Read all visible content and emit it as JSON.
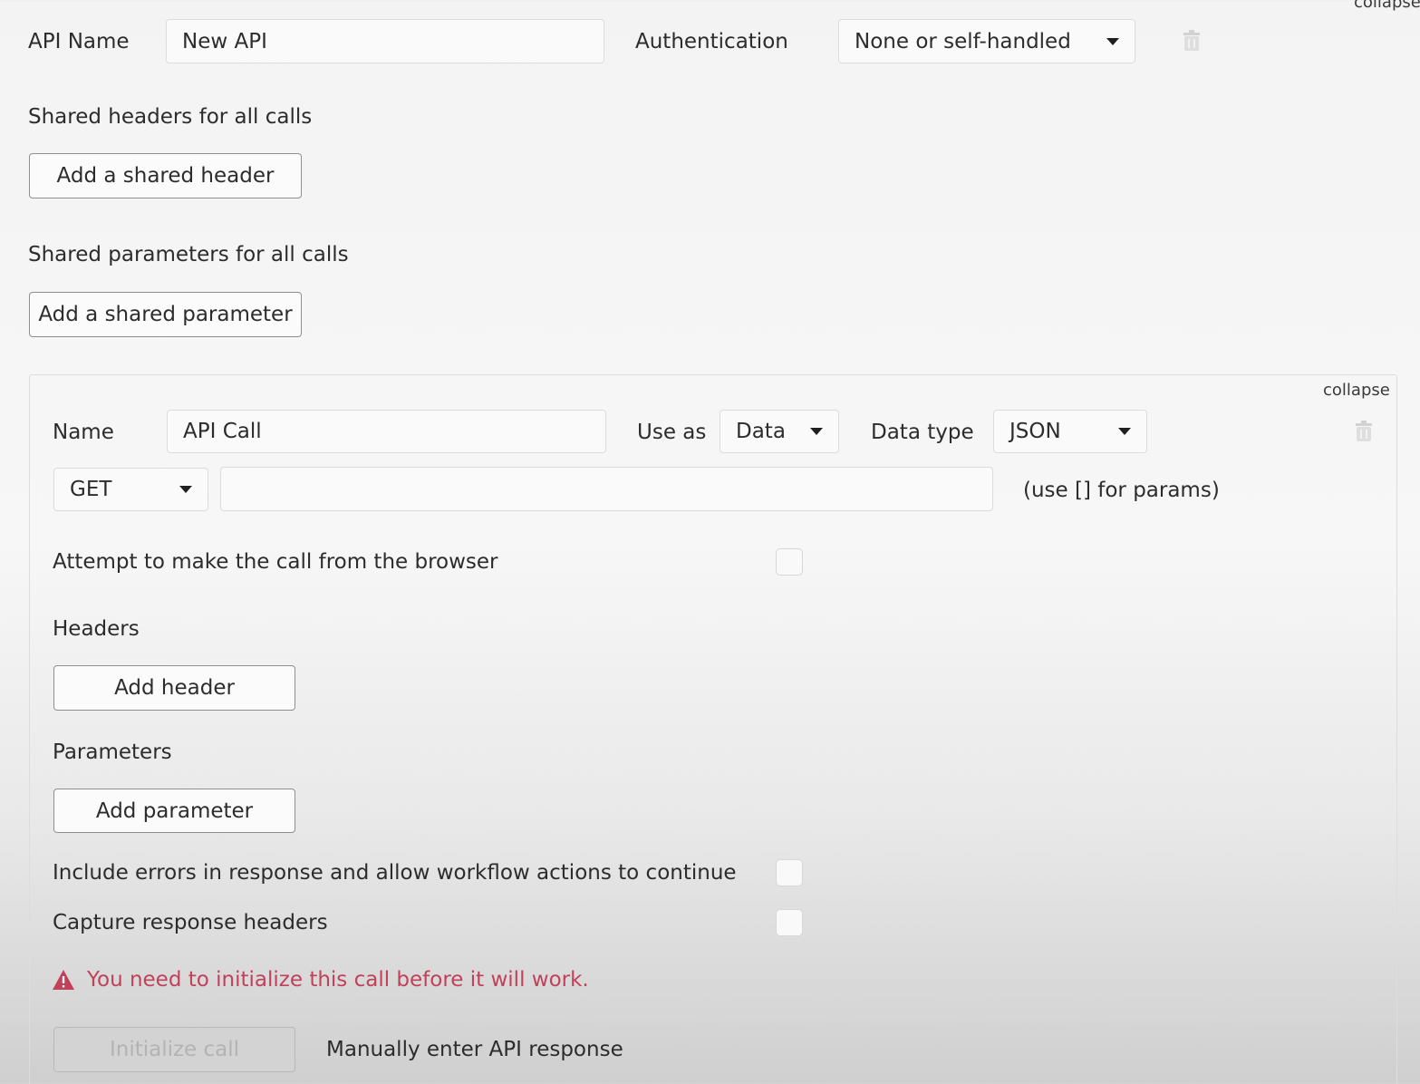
{
  "top": {
    "collapse_link": "collapse",
    "api_name_label": "API Name",
    "api_name_value": "New API",
    "authentication_label": "Authentication",
    "authentication_value": "None or self-handled"
  },
  "shared_headers": {
    "title": "Shared headers for all calls",
    "add_button": "Add a shared header"
  },
  "shared_parameters": {
    "title": "Shared parameters for all calls",
    "add_button": "Add a shared parameter"
  },
  "call": {
    "collapse_link": "collapse",
    "name_label": "Name",
    "name_value": "API Call",
    "use_as_label": "Use as",
    "use_as_value": "Data",
    "data_type_label": "Data type",
    "data_type_value": "JSON",
    "method_value": "GET",
    "url_value": "",
    "url_hint": "(use [] for params)",
    "browser_call_label": "Attempt to make the call from the browser",
    "headers_title": "Headers",
    "add_header_button": "Add header",
    "parameters_title": "Parameters",
    "add_parameter_button": "Add parameter",
    "include_errors_label": "Include errors in response and allow workflow actions to continue",
    "capture_headers_label": "Capture response headers",
    "warning_text": "You need to initialize this call before it will work.",
    "initialize_button": "Initialize call",
    "manual_response_link": "Manually enter API response"
  },
  "colors": {
    "warning": "#c2415a",
    "border": "#dcdcdc"
  }
}
